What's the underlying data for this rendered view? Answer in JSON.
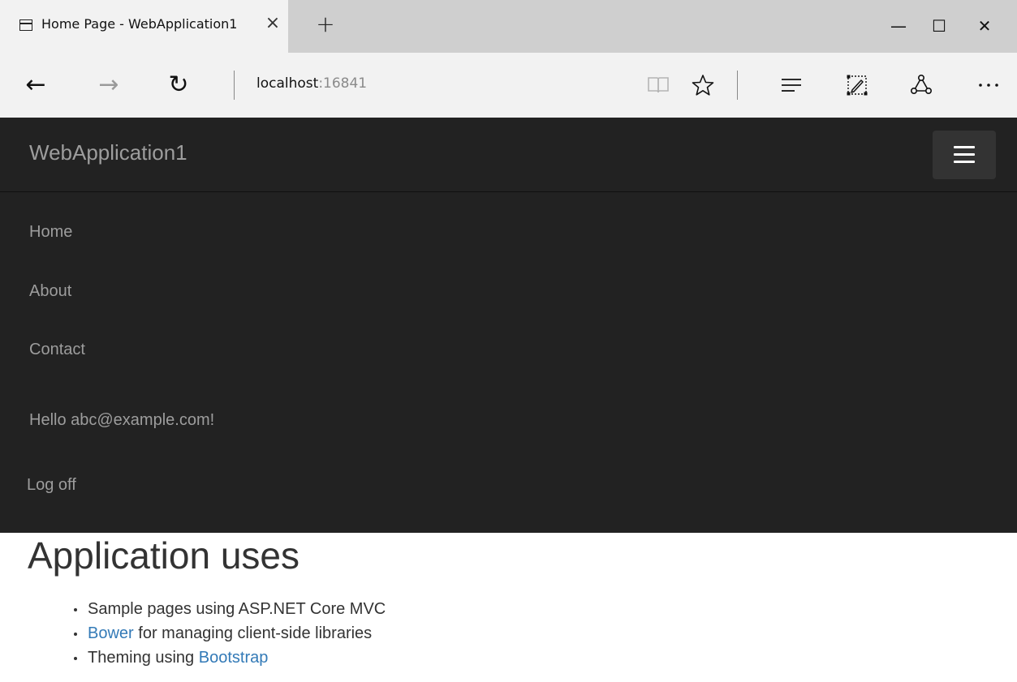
{
  "browser": {
    "tab": {
      "title": "Home Page - WebApplication1",
      "close_glyph": "×",
      "icon": "tab-page-icon"
    },
    "new_tab_glyph": "+",
    "window_controls": {
      "minimize_glyph": "—",
      "maximize_glyph": "☐",
      "close_glyph": "✕"
    },
    "nav": {
      "back_glyph": "←",
      "forward_glyph": "→",
      "refresh_glyph": "↻"
    },
    "address": {
      "host": "localhost",
      "port": ":16841"
    },
    "toolbar_icons": [
      "reading-view-icon",
      "favorite-star-icon",
      "hub-icon",
      "web-note-icon",
      "share-icon",
      "more-icon"
    ]
  },
  "site": {
    "brand": "WebApplication1",
    "toggle_icon": "hamburger-menu-icon",
    "menu": [
      {
        "label": "Home"
      },
      {
        "label": "About"
      },
      {
        "label": "Contact"
      }
    ],
    "greeting": "Hello abc@example.com!",
    "logoff": "Log off"
  },
  "content": {
    "heading": "Application uses",
    "items": [
      {
        "text": "Sample pages using ASP.NET Core MVC"
      },
      {
        "link": "Bower",
        "text": " for managing client-side libraries"
      },
      {
        "text": "Theming using ",
        "link": "Bootstrap"
      }
    ],
    "link_color": "#337ab7"
  },
  "colors": {
    "navbar_bg": "#222222",
    "navbar_text": "#9d9d9d",
    "toggle_bg": "#333333",
    "chrome_bg": "#f2f2f2",
    "tabstrip_bg": "#cfcfcf"
  }
}
